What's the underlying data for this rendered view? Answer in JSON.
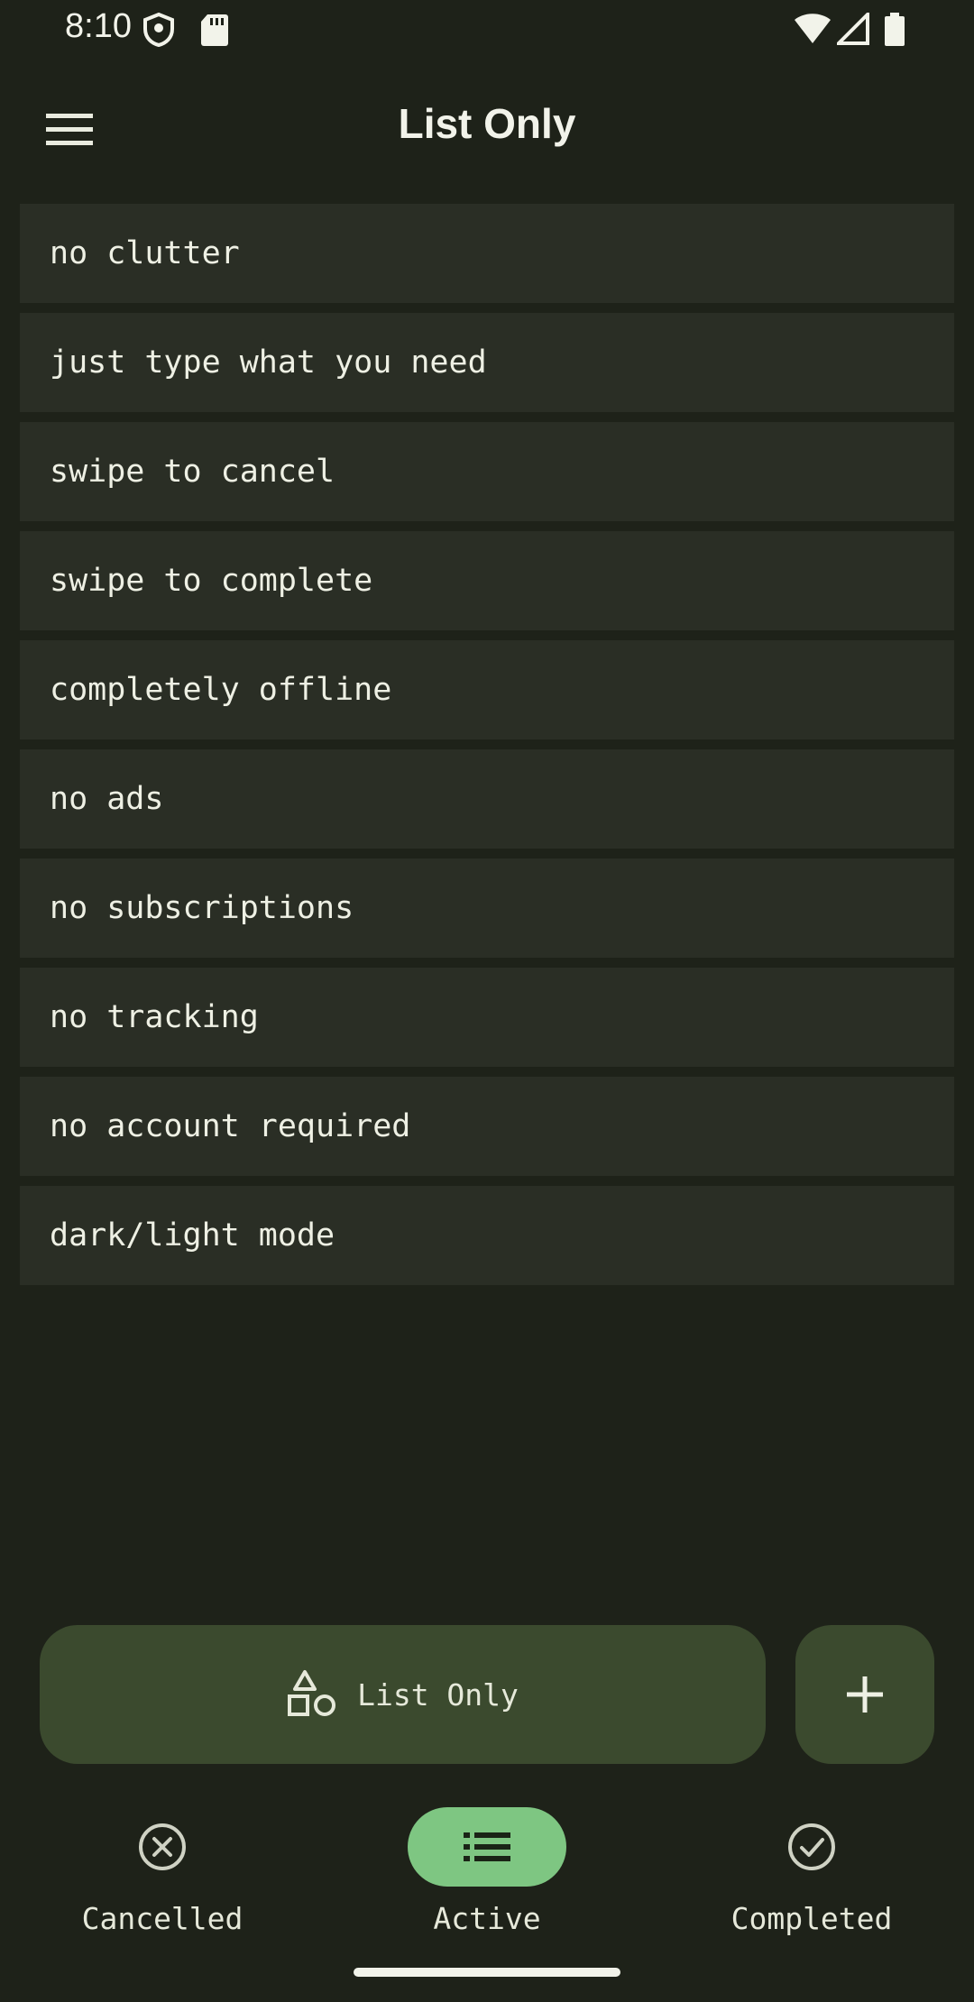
{
  "status_bar": {
    "time": "8:10"
  },
  "app_bar": {
    "title": "List Only"
  },
  "list": {
    "items": [
      "no clutter",
      "just type what you need",
      "swipe to cancel",
      "swipe to complete",
      "completely offline",
      "no ads",
      "no subscriptions",
      "no tracking",
      "no account required",
      "dark/light mode"
    ]
  },
  "actions": {
    "category_label": "List Only",
    "add_icon": "plus-icon",
    "category_icon": "shapes-icon"
  },
  "bottom_nav": {
    "items": [
      {
        "label": "Cancelled",
        "icon": "cancel-circle-icon",
        "active": false
      },
      {
        "label": "Active",
        "icon": "list-icon",
        "active": true
      },
      {
        "label": "Completed",
        "icon": "check-circle-icon",
        "active": false
      }
    ]
  },
  "colors": {
    "background": "#1e2219",
    "card": "#2a2e25",
    "button": "#3b4a2e",
    "accent": "#7ec682"
  }
}
